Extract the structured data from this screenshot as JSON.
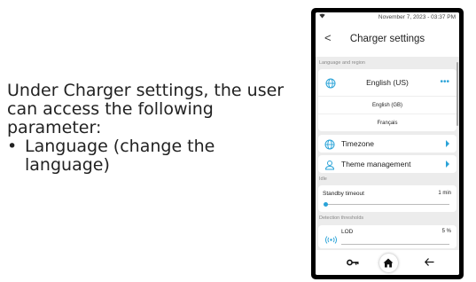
{
  "caption": {
    "intro": "Under Charger settings, the user can access the following parameter:",
    "bullets": [
      "Language (change the language)"
    ]
  },
  "status_bar": {
    "datetime": "November 7, 2023 - 03:37 PM",
    "wifi_icon": "wifi-icon"
  },
  "header": {
    "back_icon": "chevron-left-icon",
    "back_glyph": "<",
    "title": "Charger settings"
  },
  "sections": {
    "language_region": "Language and region",
    "idle": "Idle",
    "detection": "Detection thresholds"
  },
  "language": {
    "current": "English (US)",
    "options": [
      "English (GB)",
      "Français"
    ],
    "more_glyph": "•••"
  },
  "nav_items": [
    {
      "label": "Timezone",
      "icon": "globe-icon"
    },
    {
      "label": "Theme management",
      "icon": "user-icon"
    }
  ],
  "standby": {
    "label": "Standby timeout",
    "value": "1 min",
    "level": 0.0
  },
  "lod": {
    "label": "LOD",
    "value": "5 %",
    "icon": "signal-icon"
  },
  "bottom_nav": {
    "key_icon": "key-icon",
    "home_icon": "home-icon",
    "back_icon": "arrow-left-icon"
  },
  "colors": {
    "accent": "#2aa3d8",
    "screen_bg": "#ececec",
    "bezel": "#000000"
  }
}
